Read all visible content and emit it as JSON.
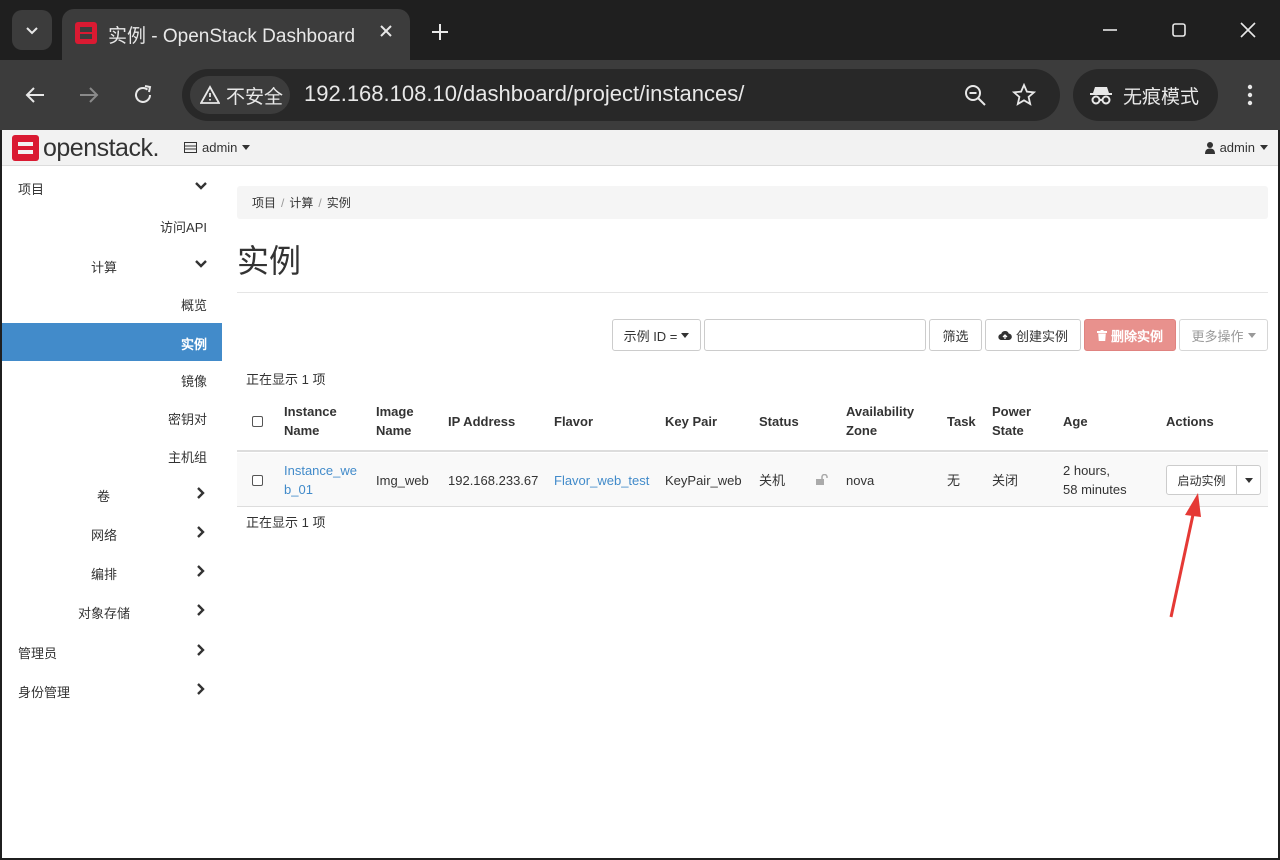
{
  "browser": {
    "tab_title": "实例 - OpenStack Dashboard",
    "security_label": "不安全",
    "url": "192.168.108.10/dashboard/project/instances/",
    "incognito_label": "无痕模式"
  },
  "topnav": {
    "logo_text": "openstack.",
    "project": "admin",
    "user": "admin"
  },
  "sidebar": {
    "items": [
      {
        "label": "项目"
      },
      {
        "label": "访问API"
      },
      {
        "label": "计算"
      },
      {
        "label": "概览"
      },
      {
        "label": "实例"
      },
      {
        "label": "镜像"
      },
      {
        "label": "密钥对"
      },
      {
        "label": "主机组"
      },
      {
        "label": "卷"
      },
      {
        "label": "网络"
      },
      {
        "label": "编排"
      },
      {
        "label": "对象存储"
      },
      {
        "label": "管理员"
      },
      {
        "label": "身份管理"
      }
    ]
  },
  "breadcrumb": [
    "项目",
    "计算",
    "实例"
  ],
  "page_title": "实例",
  "filter": {
    "field_label": "示例 ID =",
    "value": "",
    "filter_button": "筛选",
    "create_button": "创建实例",
    "delete_button": "删除实例",
    "more_button": "更多操作"
  },
  "count_text": "正在显示 1 项",
  "table": {
    "headers": {
      "name_1": "Instance",
      "name_2": "Name",
      "image_1": "Image",
      "image_2": "Name",
      "ip": "IP Address",
      "flavor": "Flavor",
      "keypair": "Key Pair",
      "status": "Status",
      "az_1": "Availability",
      "az_2": "Zone",
      "task": "Task",
      "power_1": "Power",
      "power_2": "State",
      "age": "Age",
      "actions": "Actions"
    },
    "rows": [
      {
        "name_1": "Instance_we",
        "name_2": "b_01",
        "image": "Img_web",
        "ip": "192.168.233.67",
        "flavor": "Flavor_web_test",
        "keypair": "KeyPair_web",
        "status": "关机",
        "az": "nova",
        "task": "无",
        "power": "关闭",
        "age_1": "2 hours,",
        "age_2": "58 minutes",
        "action": "启动实例"
      }
    ]
  },
  "colors": {
    "accent": "#428bca",
    "danger_button": "#e8918d",
    "annotation_arrow": "#e53935",
    "openstack_red": "#da1a32"
  }
}
